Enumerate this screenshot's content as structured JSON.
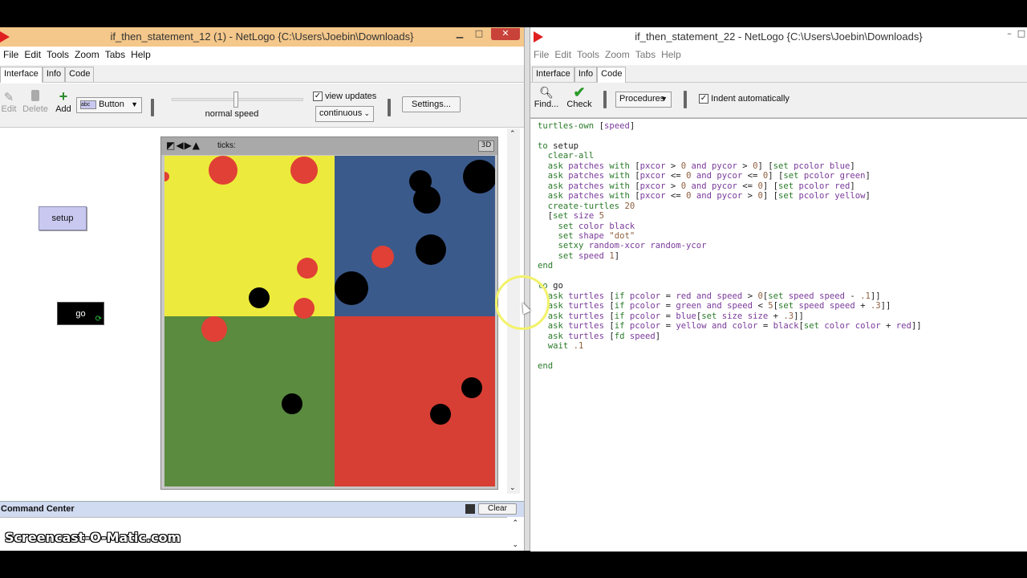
{
  "left_window": {
    "title": "if_then_statement_12 (1) - NetLogo {C:\\Users\\Joebin\\Downloads}",
    "menu": [
      "File",
      "Edit",
      "Tools",
      "Zoom",
      "Tabs",
      "Help"
    ],
    "tabs": [
      "Interface",
      "Info",
      "Code"
    ],
    "active_tab": "Interface",
    "toolbar": {
      "edit": "Edit",
      "delete": "Delete",
      "add": "Add",
      "widget_type": "Button",
      "speed_label": "normal speed",
      "view_updates_label": "view updates",
      "view_updates_checked": true,
      "update_mode": "continuous",
      "settings_label": "Settings..."
    },
    "buttons": {
      "setup": "setup",
      "go": "go"
    },
    "view": {
      "ticks_label": "ticks:",
      "three_d": "3D"
    },
    "command_center": {
      "title": "Command Center",
      "clear": "Clear"
    },
    "patch_colors": {
      "top_left": "#ecea3c",
      "top_right": "#3b5a8c",
      "bottom_left": "#5a8b3e",
      "bottom_right": "#d73e34"
    },
    "turtle_colors": {
      "red": "#e04035",
      "black": "#000000"
    }
  },
  "right_window": {
    "title": "if_then_statement_22 - NetLogo {C:\\Users\\Joebin\\Downloads}",
    "menu": [
      "File",
      "Edit",
      "Tools",
      "Zoom",
      "Tabs",
      "Help"
    ],
    "tabs": [
      "Interface",
      "Info",
      "Code"
    ],
    "active_tab": "Code",
    "toolbar": {
      "find": "Find...",
      "check": "Check",
      "procedures": "Procedures",
      "indent_label": "Indent automatically",
      "indent_checked": true
    },
    "code": "turtles-own [speed]\n\nto setup\n  clear-all\n  ask patches with [pxcor > 0 and pycor > 0] [set pcolor blue]\n  ask patches with [pxcor <= 0 and pycor <= 0] [set pcolor green]\n  ask patches with [pxcor > 0 and pycor <= 0] [set pcolor red]\n  ask patches with [pxcor <= 0 and pycor > 0] [set pcolor yellow]\n  create-turtles 20\n  [set size 5\n    set color black\n    set shape \"dot\"\n    setxy random-xcor random-ycor\n    set speed 1]\nend\n\nto go\n  ask turtles [if pcolor = red and speed > 0[set speed speed - .1]]\n  ask turtles [if pcolor = green and speed < 5[set speed speed + .3]]\n  ask turtles [if pcolor = blue[set size size + .3]]\n  ask turtles [if pcolor = yellow and color = black[set color color + red]]\n  ask turtles [fd speed]\n  wait .1\n\nend"
  },
  "watermark": "Screencast-O-Matic.com"
}
